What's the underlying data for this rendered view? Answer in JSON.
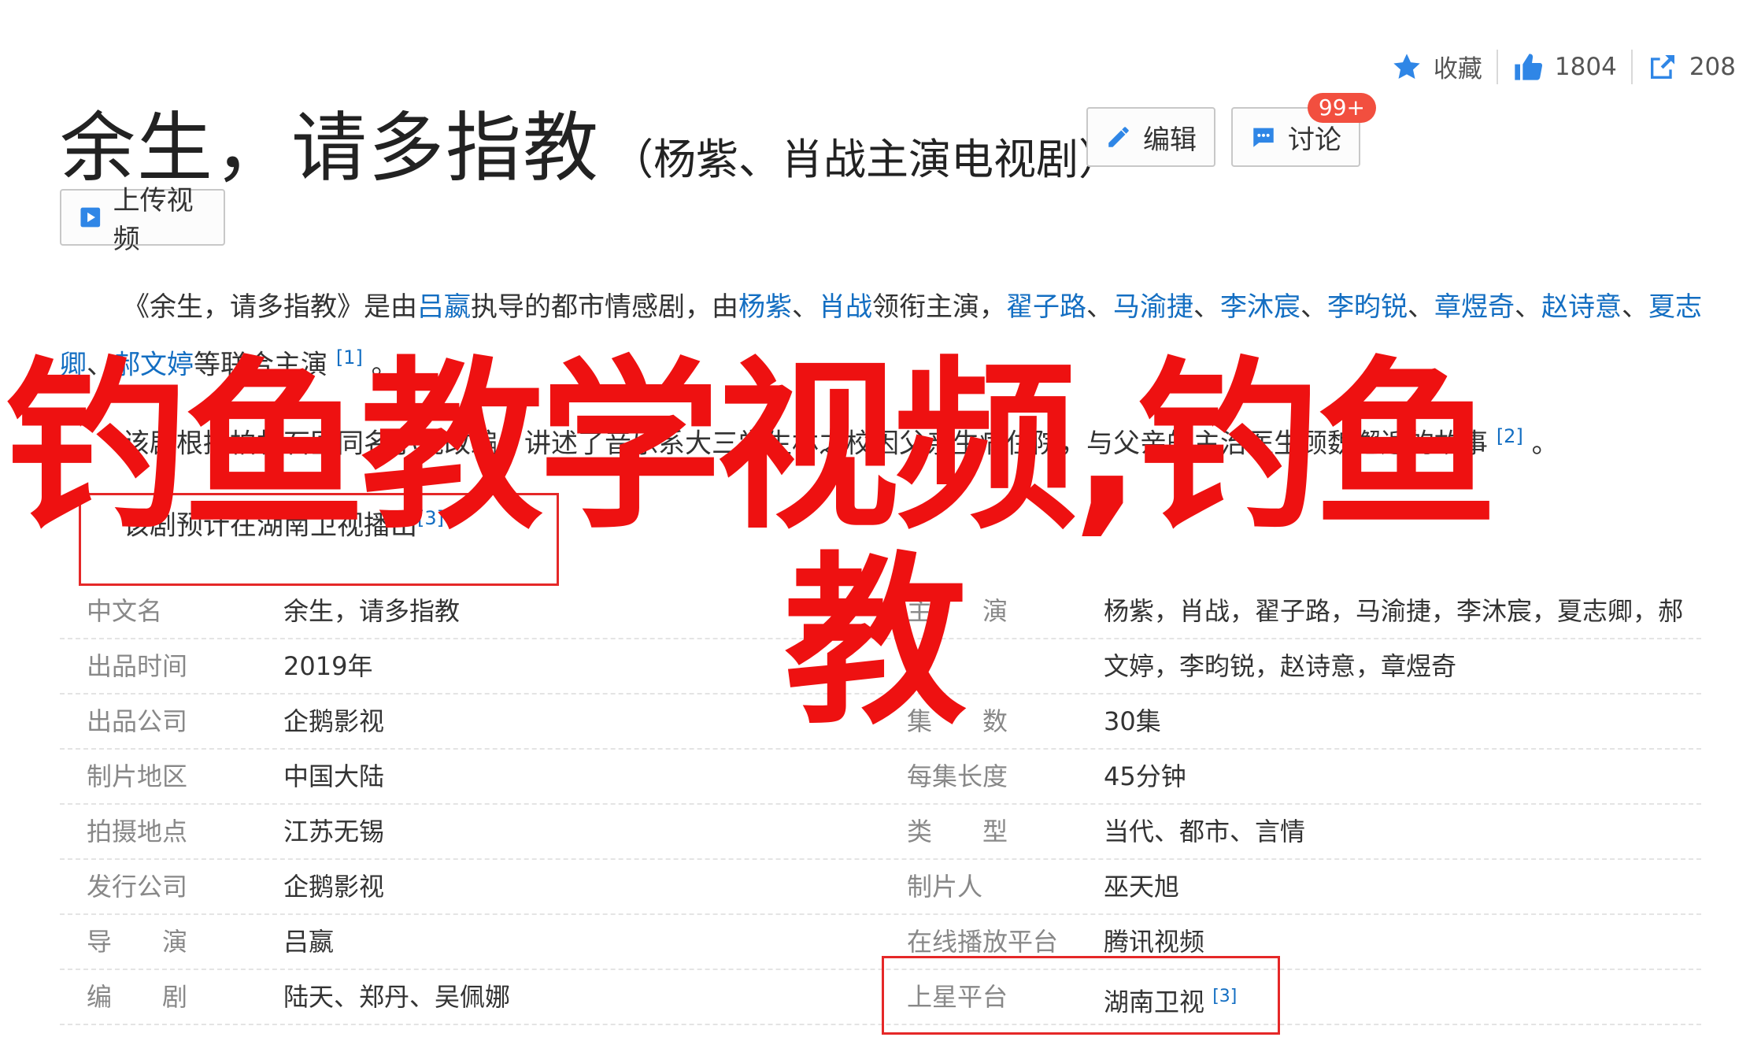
{
  "actions": {
    "favorite_label": "收藏",
    "like_count": "1804",
    "share_count": "208"
  },
  "title": {
    "main": "余生，请多指教",
    "sub": "（杨紫、肖战主演电视剧）"
  },
  "buttons": {
    "edit": "编辑",
    "discuss": "讨论",
    "discuss_badge": "99+",
    "upload_video": "上传视频"
  },
  "intro": {
    "p1_prefix": "《余生，请多指教》是由",
    "director": "吕嬴",
    "p1_mid": "执导的都市情感剧，由",
    "lead1": "杨紫",
    "sep1": "、",
    "lead2": "肖战",
    "p1_mid2": "领衔主演，",
    "cast": [
      "翟子路",
      "马渝捷",
      "李沐宸",
      "李昀锐",
      "章煜奇",
      "赵诗意",
      "夏志卿",
      "郝文婷"
    ],
    "p1_suffix": "等联合主演",
    "p1_ref": "[1]",
    "p1_end": "。",
    "p2": "该剧根据柏林石匠同名小说改编，讲述了音乐系大三学生林之校因父亲生病住院，与父亲的主治医生顾魏邂逅的故事",
    "p2_ref": "[2]",
    "p2_end": "。",
    "p3": "该剧预计在湖南卫视播出",
    "p3_ref": "[3]"
  },
  "info_rows": [
    {
      "k1": "中文名",
      "v1": "余生，请多指教",
      "k2": "主　　演",
      "v2": "杨紫，肖战，翟子路，马渝捷，李沐宸，夏志卿，郝"
    },
    {
      "k1": "出品时间",
      "v1": "2019年",
      "k2": "",
      "v2": "文婷，李昀锐，赵诗意，章煜奇"
    },
    {
      "k1": "出品公司",
      "v1": "企鹅影视",
      "k2": "集　　数",
      "v2": "30集"
    },
    {
      "k1": "制片地区",
      "v1": "中国大陆",
      "k2": "每集长度",
      "v2": "45分钟"
    },
    {
      "k1": "拍摄地点",
      "v1": "江苏无锡",
      "k2": "类　　型",
      "v2": "当代、都市、言情"
    },
    {
      "k1": "发行公司",
      "v1": "企鹅影视",
      "k2": "制片人",
      "v2": "巫天旭"
    },
    {
      "k1": "导　　演",
      "v1": "吕嬴",
      "k2": "在线播放平台",
      "v2": "腾讯视频"
    },
    {
      "k1": "编　　剧",
      "v1": "陆天、郑丹、吴佩娜",
      "k2": "上星平台",
      "v2": "湖南卫视",
      "v2_ref": "[3]"
    }
  ],
  "overlay": {
    "line1": "钓鱼教学视频,钓鱼",
    "line2": "教"
  },
  "colors": {
    "link": "#136ec2",
    "overlay_red": "#ee1111",
    "badge_red": "#f24f3f",
    "icon_blue": "#2f86e6"
  }
}
